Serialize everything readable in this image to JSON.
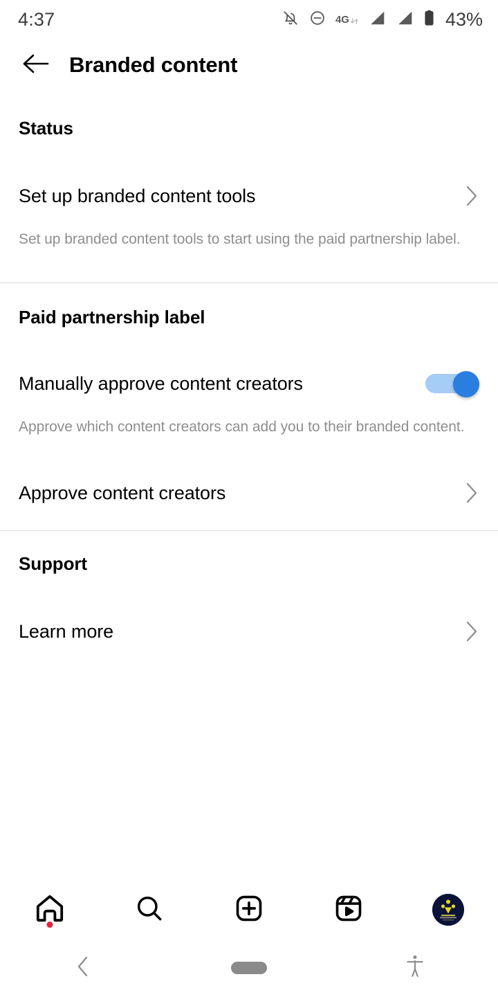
{
  "status_bar": {
    "time": "4:37",
    "battery_percent": "43%",
    "network_type": "4G",
    "icons": [
      "bell-muted-icon",
      "do-not-disturb-icon",
      "mobile-data-4g-icon",
      "signal-bars-sim1-icon",
      "signal-bars-sim2-icon",
      "battery-icon"
    ]
  },
  "header": {
    "title": "Branded content",
    "back_icon": "arrow-left-icon"
  },
  "sections": [
    {
      "id": "status",
      "title": "Status",
      "rows": [
        {
          "label": "Set up branded content tools",
          "accessory": "chevron-right-icon",
          "description": "Set up branded content tools to start using the paid partnership label."
        }
      ]
    },
    {
      "id": "paid-partnership-label",
      "title": "Paid partnership label",
      "rows": [
        {
          "label": "Manually approve content creators",
          "accessory": "toggle",
          "toggle_on": true,
          "description": "Approve which content creators can add you to their branded content."
        },
        {
          "label": "Approve content creators",
          "accessory": "chevron-right-icon",
          "description": ""
        }
      ]
    },
    {
      "id": "support",
      "title": "Support",
      "rows": [
        {
          "label": "Learn more",
          "accessory": "chevron-right-icon",
          "description": ""
        }
      ]
    }
  ],
  "tab_bar": {
    "tabs": [
      {
        "name": "home",
        "icon": "home-icon",
        "badge": true
      },
      {
        "name": "search",
        "icon": "search-icon",
        "badge": false
      },
      {
        "name": "create",
        "icon": "plus-square-icon",
        "badge": false
      },
      {
        "name": "reels",
        "icon": "reels-icon",
        "badge": false
      },
      {
        "name": "profile",
        "icon": "profile-avatar-icon",
        "badge": false
      }
    ]
  },
  "system_nav": {
    "back_icon": "chevron-left-icon",
    "home_icon": "home-pill-icon",
    "accessibility_icon": "accessibility-icon"
  },
  "colors": {
    "accent_toggle_thumb": "#2a7ee0",
    "accent_toggle_track": "#a6cdf6",
    "text_primary": "#000000",
    "text_secondary": "#8e8e8e",
    "divider": "#dbdbdb",
    "badge": "#e8233a",
    "avatar_bg": "#0b1338"
  }
}
